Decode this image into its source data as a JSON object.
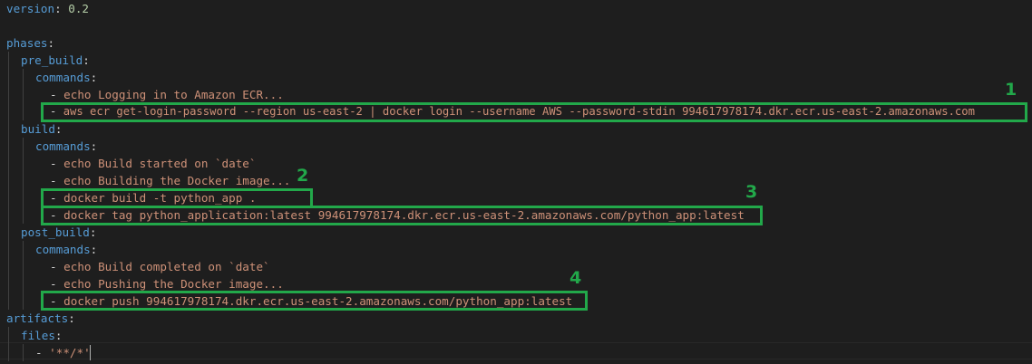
{
  "editor": {
    "lines": [
      {
        "key": "version",
        "sep": ":",
        "value": " 0.2"
      },
      {
        "text": ""
      },
      {
        "key": "phases",
        "sep": ":"
      },
      {
        "key": "pre_build",
        "sep": ":"
      },
      {
        "key": "commands",
        "sep": ":"
      },
      {
        "dash": "- ",
        "text": "echo Logging in to Amazon ECR..."
      },
      {
        "dash": "- ",
        "text": "aws ecr get-login-password --region us-east-2 | docker login --username AWS --password-stdin 994617978174.dkr.ecr.us-east-2.amazonaws.com"
      },
      {
        "key": "build",
        "sep": ":"
      },
      {
        "key": "commands",
        "sep": ":"
      },
      {
        "dash": "- ",
        "text": "echo Build started on `date`"
      },
      {
        "dash": "- ",
        "text": "echo Building the Docker image..."
      },
      {
        "dash": "- ",
        "text": "docker build -t python_app ."
      },
      {
        "dash": "- ",
        "text": "docker tag python_application:latest 994617978174.dkr.ecr.us-east-2.amazonaws.com/python_app:latest"
      },
      {
        "key": "post_build",
        "sep": ":"
      },
      {
        "key": "commands",
        "sep": ":"
      },
      {
        "dash": "- ",
        "text": "echo Build completed on `date`"
      },
      {
        "dash": "- ",
        "text": "echo Pushing the Docker image..."
      },
      {
        "dash": "- ",
        "text": "docker push 994617978174.dkr.ecr.us-east-2.amazonaws.com/python_app:latest"
      },
      {
        "key": "artifacts",
        "sep": ":"
      },
      {
        "key": "files",
        "sep": ":"
      },
      {
        "dash": "- ",
        "text": "'**/*'"
      }
    ]
  },
  "annotations": [
    {
      "label": "1"
    },
    {
      "label": "2"
    },
    {
      "label": "3"
    },
    {
      "label": "4"
    }
  ],
  "colors": {
    "background": "#1e1e1e",
    "key": "#569cd6",
    "string": "#ce9178",
    "number": "#b5cea8",
    "highlight": "#22a84a"
  }
}
